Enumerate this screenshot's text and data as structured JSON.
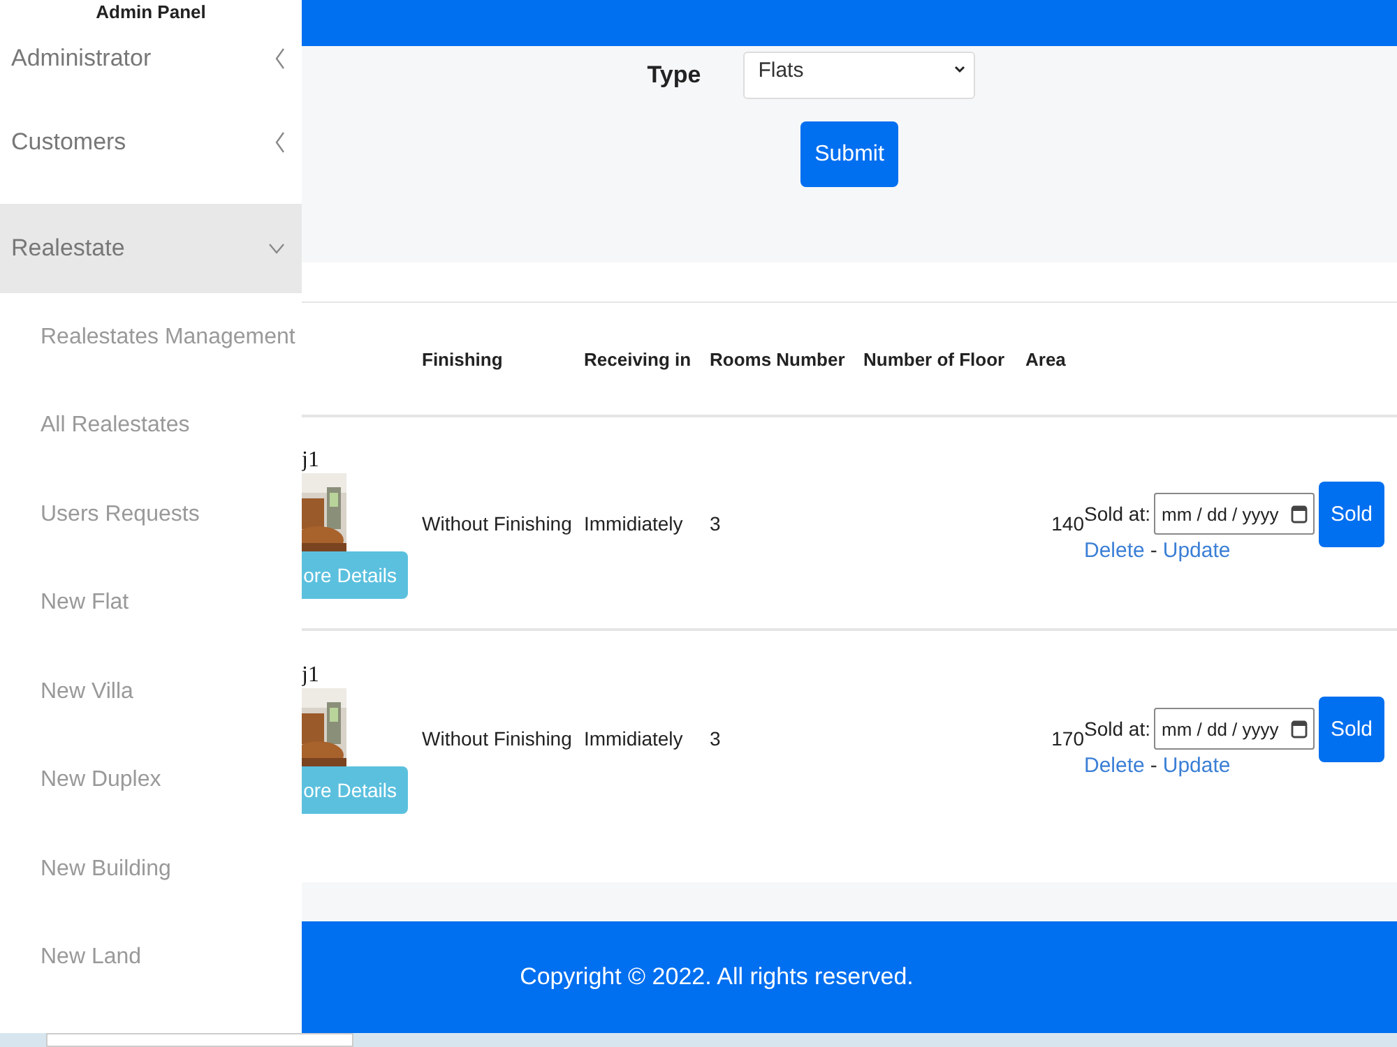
{
  "sidebar": {
    "title": "Admin Panel",
    "items": [
      {
        "label": "Administrator",
        "expanded": false,
        "selected": false
      },
      {
        "label": "Customers",
        "expanded": false,
        "selected": false
      },
      {
        "label": "Realestate",
        "expanded": true,
        "selected": true,
        "children": [
          {
            "label": "Realestates Management"
          },
          {
            "label": "All Realestates"
          },
          {
            "label": "Users Requests"
          },
          {
            "label": "New Flat"
          },
          {
            "label": "New Villa"
          },
          {
            "label": "New Duplex"
          },
          {
            "label": "New Building"
          },
          {
            "label": "New Land"
          }
        ]
      }
    ]
  },
  "filter": {
    "label": "Type",
    "value": "Flats",
    "submit": "Submit"
  },
  "table": {
    "columns": [
      "Finishing",
      "Receiving in",
      "Rooms Number",
      "Number of Floor",
      "Area"
    ],
    "rows": [
      {
        "name": "j1",
        "details": "ore Details",
        "finishing": "Without Finishing",
        "receiving": "Immidiately",
        "rooms": "3",
        "area": "140",
        "sold_label": "Sold at:",
        "date_placeholder": "mm / dd / yyyy",
        "sold": "Sold",
        "delete": "Delete",
        "separator": "-",
        "update": "Update"
      },
      {
        "name": "j1",
        "details": "ore Details",
        "finishing": "Without Finishing",
        "receiving": "Immidiately",
        "rooms": "3",
        "area": "170",
        "sold_label": "Sold at:",
        "date_placeholder": "mm / dd / yyyy",
        "sold": "Sold",
        "delete": "Delete",
        "separator": "-",
        "update": "Update"
      }
    ]
  },
  "footer": {
    "text": "Copyright © 2022. All rights reserved."
  }
}
